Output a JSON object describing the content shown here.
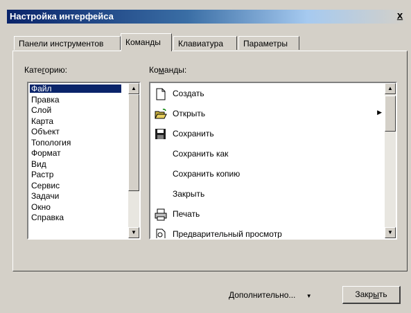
{
  "window": {
    "title": "Настройка интерфейса",
    "close_glyph": "x"
  },
  "tabs": [
    {
      "label": "Панели инструментов"
    },
    {
      "label": "Команды"
    },
    {
      "label": "Клавиатура"
    },
    {
      "label": "Параметры"
    }
  ],
  "active_tab": "Команды",
  "categories": {
    "label_pre": "Кате",
    "label_u": "г",
    "label_post": "орию:",
    "items": [
      "Файл",
      "Правка",
      "Слой",
      "Карта",
      "Объект",
      "Топология",
      "Формат",
      "Вид",
      "Растр",
      "Сервис",
      "Задачи",
      "Окно",
      "Справка"
    ],
    "selected": "Файл"
  },
  "commands": {
    "label_pre": "Ко",
    "label_u": "м",
    "label_post": "анды:",
    "items": [
      {
        "label": "Создать",
        "icon": "new-document-icon"
      },
      {
        "label": "Открыть",
        "icon": "open-folder-icon",
        "submenu": true
      },
      {
        "label": "Сохранить",
        "icon": "save-disk-icon"
      },
      {
        "label": "Сохранить как",
        "icon": ""
      },
      {
        "label": "Сохранить копию",
        "icon": ""
      },
      {
        "label": "Закрыть",
        "icon": ""
      },
      {
        "label": "Печать",
        "icon": "printer-icon"
      },
      {
        "label": "Предварительный просмотр",
        "icon": "print-preview-icon"
      }
    ]
  },
  "footer": {
    "more_label": "Дополнительно...",
    "more_arrow": "▼",
    "close_pre": "Закр",
    "close_u": "ы",
    "close_post": "ть"
  },
  "colors": {
    "selection": "#0a246a",
    "title_gradient_start": "#0a246a",
    "face": "#d4d0c8"
  }
}
